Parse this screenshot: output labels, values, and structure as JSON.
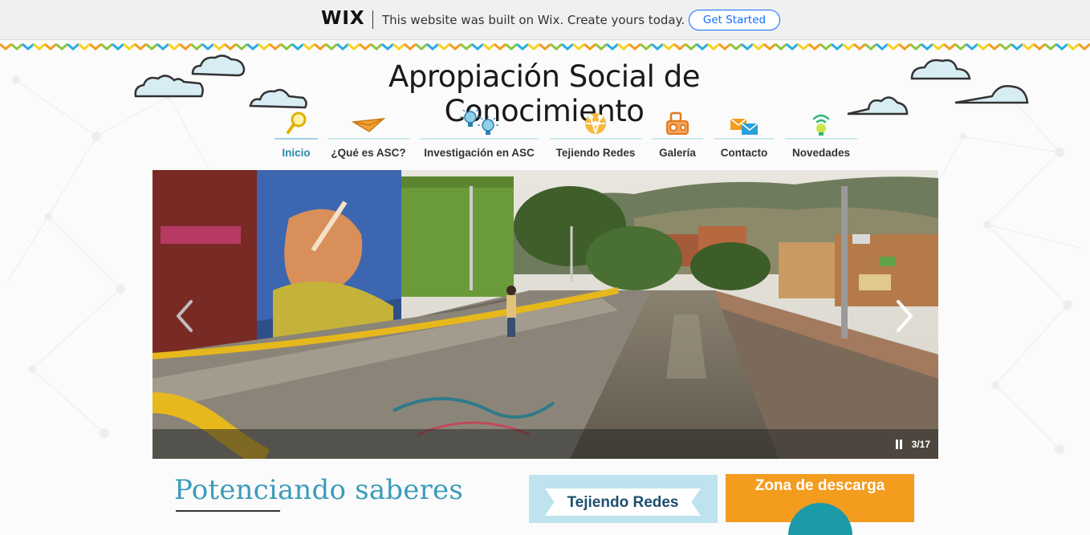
{
  "wix_banner": {
    "logo": "WIX",
    "message": "This website was built on Wix. Create yours today.",
    "cta": "Get Started"
  },
  "site": {
    "title": "Apropiación Social de Conocimiento"
  },
  "nav": {
    "items": [
      {
        "label": "Inicio",
        "icon": "magnifier-icon",
        "active": true
      },
      {
        "label": "¿Qué es ASC?",
        "icon": "paper-plane-icon",
        "active": false
      },
      {
        "label": "Investigación en ASC",
        "icon": "lightbulbs-icon",
        "active": false
      },
      {
        "label": "Tejiendo Redes",
        "icon": "people-network-icon",
        "active": false
      },
      {
        "label": "Galería",
        "icon": "camera-icon",
        "active": false
      },
      {
        "label": "Contacto",
        "icon": "envelopes-icon",
        "active": false
      },
      {
        "label": "Novedades",
        "icon": "bulb-news-icon",
        "active": false
      }
    ]
  },
  "slideshow": {
    "current": 3,
    "total": 17,
    "counter_text": "3/17",
    "prev_icon": "chevron-left-icon",
    "next_icon": "chevron-right-icon",
    "pause_icon": "pause-icon"
  },
  "content": {
    "heading": "Potenciando saberes",
    "card_tejiendo": "Tejiendo Redes",
    "card_descarga": "Zona de descarga"
  },
  "colors": {
    "accent": "#2a8aa6",
    "heading": "#3a9cbc",
    "wix_blue": "#116dff",
    "download_orange": "#f39c1e",
    "tejiendo_bg": "#bfe3ee"
  }
}
